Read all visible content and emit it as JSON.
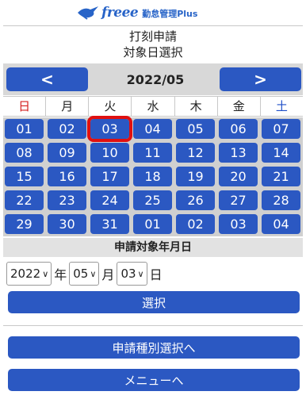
{
  "header": {
    "brand": "freee",
    "product": "勤怠管理Plus"
  },
  "title": {
    "line1": "打刻申請",
    "line2": "対象日選択"
  },
  "calendar": {
    "prev_label": "<",
    "next_label": ">",
    "month_label": "2022/05",
    "weekdays": [
      "日",
      "月",
      "火",
      "水",
      "木",
      "金",
      "土"
    ],
    "weeks": [
      [
        "01",
        "02",
        "03",
        "04",
        "05",
        "06",
        "07"
      ],
      [
        "08",
        "09",
        "10",
        "11",
        "12",
        "13",
        "14"
      ],
      [
        "15",
        "16",
        "17",
        "18",
        "19",
        "20",
        "21"
      ],
      [
        "22",
        "23",
        "24",
        "25",
        "26",
        "27",
        "28"
      ],
      [
        "29",
        "30",
        "31",
        "01",
        "02",
        "03",
        "04"
      ]
    ],
    "selected_day": "03",
    "colors": {
      "day_button": "#2b58c2",
      "selected_outline": "#e01010",
      "sunday": "#d42020",
      "saturday": "#2050c8"
    }
  },
  "target_date": {
    "label": "申請対象年月日",
    "year": "2022",
    "year_unit": "年",
    "month": "05",
    "month_unit": "月",
    "day": "03",
    "day_unit": "日"
  },
  "buttons": {
    "select": "選択",
    "request_type": "申請種別選択へ",
    "menu": "メニューへ"
  }
}
